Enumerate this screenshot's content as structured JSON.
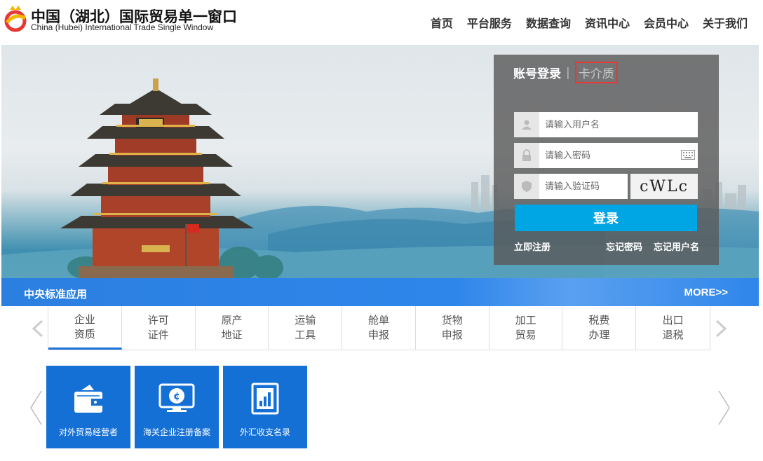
{
  "header": {
    "title": "中国（湖北）国际贸易单一窗口",
    "subtitle": "China (Hubei) International Trade Single Window"
  },
  "nav": {
    "items": [
      "首页",
      "平台服务",
      "数据查询",
      "资讯中心",
      "会员中心",
      "关于我们"
    ]
  },
  "login": {
    "tab_account": "账号登录",
    "tab_separator": "|",
    "tab_card": "卡介质",
    "username_placeholder": "请输入用户名",
    "password_placeholder": "请输入密码",
    "captcha_placeholder": "请输入验证码",
    "captcha_text": "cWLc",
    "submit_label": "登录",
    "register_link": "立即注册",
    "forgot_password_link": "忘记密码",
    "forgot_username_link": "忘记用户名"
  },
  "section": {
    "title": "中央标准应用",
    "more": "MORE>>"
  },
  "categories": [
    {
      "line1": "企业",
      "line2": "资质"
    },
    {
      "line1": "许可",
      "line2": "证件"
    },
    {
      "line1": "原产",
      "line2": "地证"
    },
    {
      "line1": "运输",
      "line2": "工具"
    },
    {
      "line1": "舱单",
      "line2": "申报"
    },
    {
      "line1": "货物",
      "line2": "申报"
    },
    {
      "line1": "加工",
      "line2": "贸易"
    },
    {
      "line1": "税费",
      "line2": "办理"
    },
    {
      "line1": "出口",
      "line2": "退税"
    }
  ],
  "tiles": [
    {
      "label": "对外贸易经营者",
      "icon": "wallet-icon"
    },
    {
      "label": "海关企业注册备案",
      "icon": "monitor-currency-icon"
    },
    {
      "label": "外汇收支名录",
      "icon": "ledger-chart-icon"
    }
  ],
  "colors": {
    "accent": "#00a6e4",
    "section_blue": "#2f86ea",
    "tile_blue": "#1570d6",
    "card_tab_highlight": "#e53935"
  }
}
